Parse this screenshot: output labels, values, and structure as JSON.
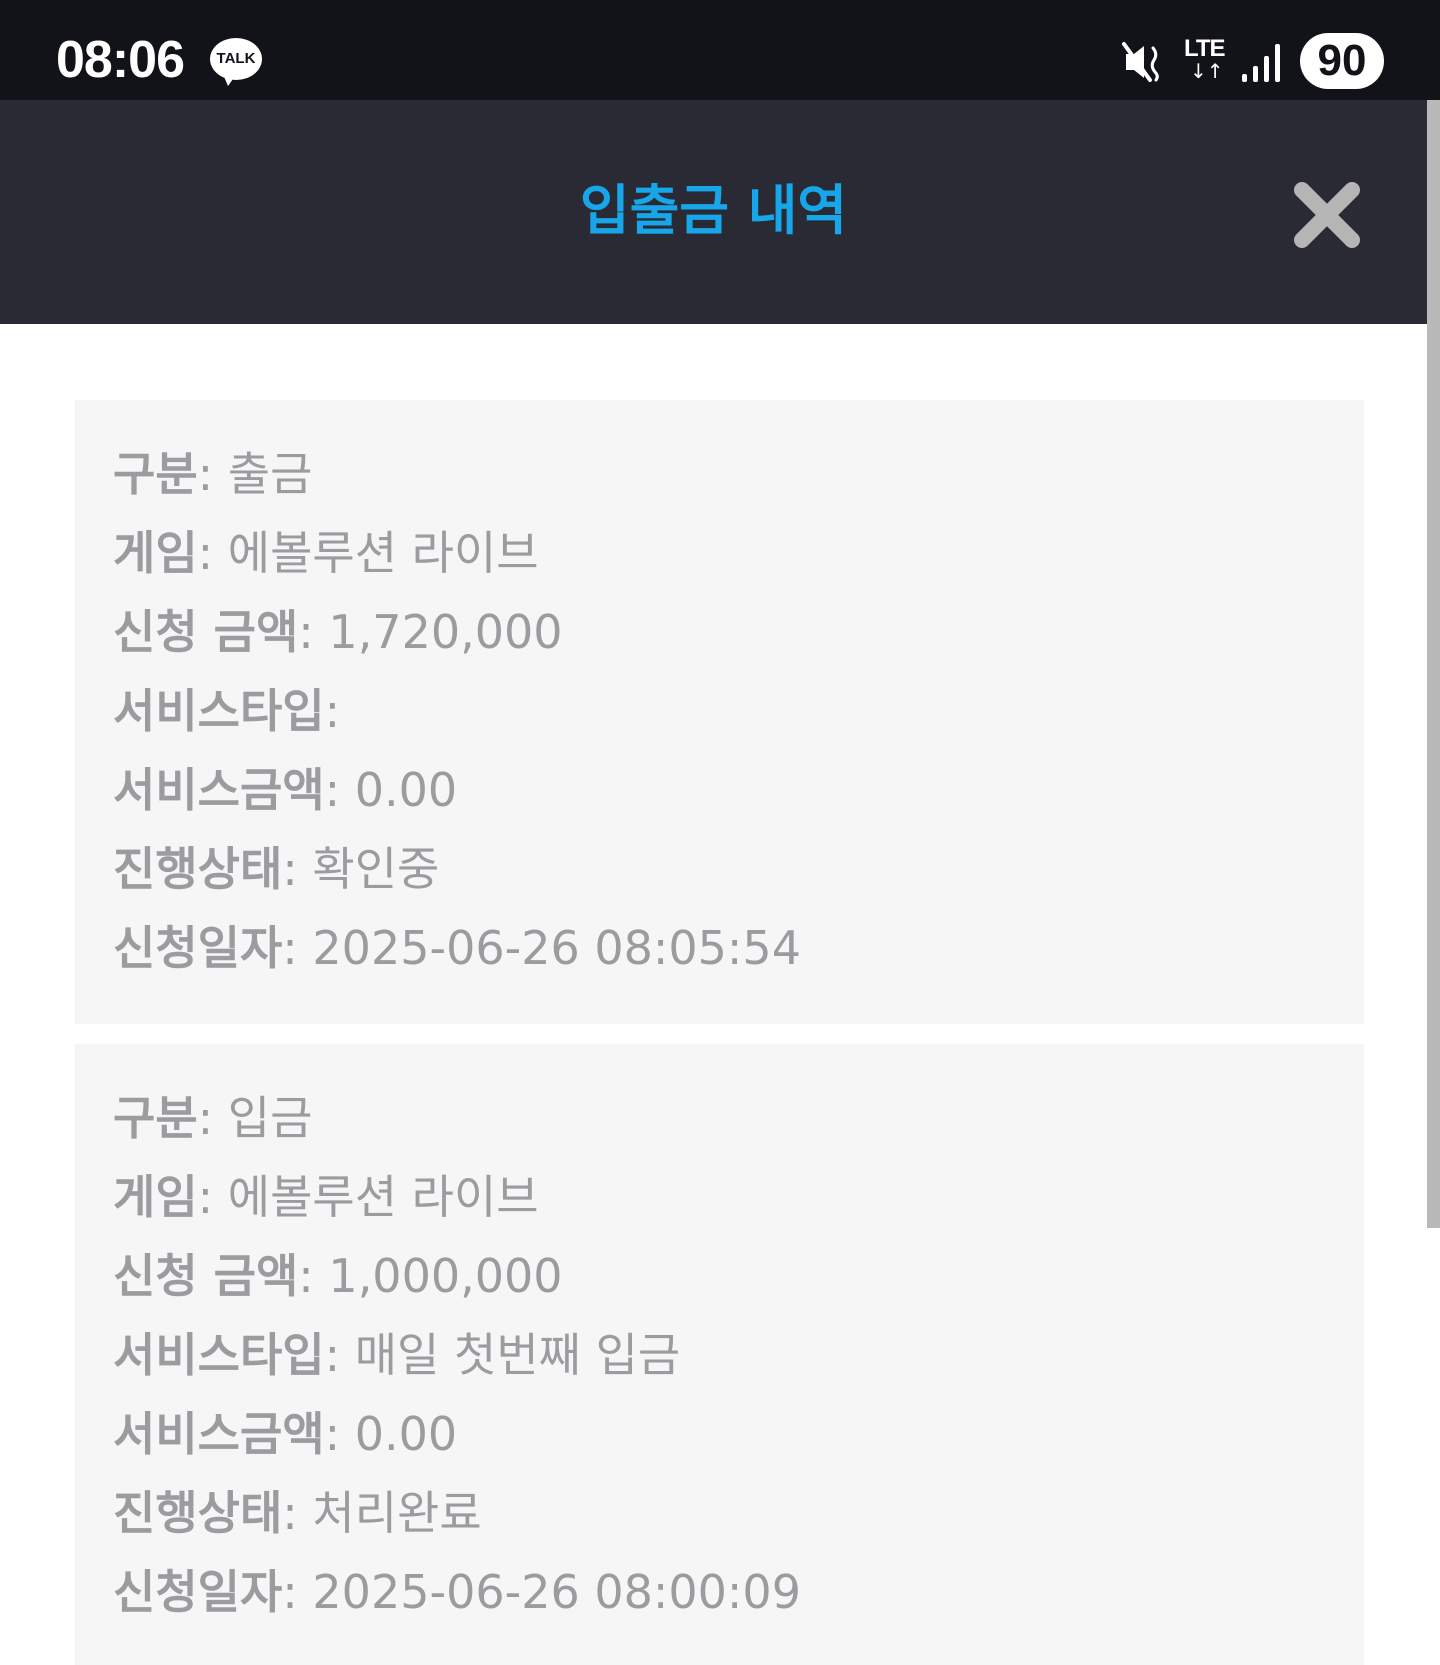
{
  "status_bar": {
    "time": "08:06",
    "talk_label": "TALK",
    "network_type": "LTE",
    "network_arrows": "↓↑",
    "battery_level": "90",
    "icons": [
      "kakaotalk-notification-icon",
      "mute-icon",
      "lte-icon",
      "signal-icon",
      "battery-icon"
    ]
  },
  "modal": {
    "title": "입출금 내역",
    "close_icon": "close-icon"
  },
  "labels": {
    "category": "구분",
    "game": "게임",
    "request_amount": "신청 금액",
    "service_type": "서비스타입",
    "service_amount": "서비스금액",
    "progress_status": "진행상태",
    "request_date": "신청일자",
    "separator": ": "
  },
  "records": [
    {
      "category": "출금",
      "game": "에볼루션 라이브",
      "request_amount": "1,720,000",
      "service_type": "",
      "service_amount": "0.00",
      "progress_status": "확인중",
      "request_date": "2025-06-26 08:05:54"
    },
    {
      "category": "입금",
      "game": "에볼루션 라이브",
      "request_amount": "1,000,000",
      "service_type": "매일 첫번째 입금",
      "service_amount": "0.00",
      "progress_status": "처리완료",
      "request_date": "2025-06-26 08:00:09"
    }
  ],
  "colors": {
    "status_bar_bg": "#121318",
    "header_bg": "#2a2a35",
    "title_accent": "#17a6e9",
    "close_icon": "#b5b5b5",
    "card_bg": "#f6f6f6",
    "field_text": "#9b9ba0"
  }
}
